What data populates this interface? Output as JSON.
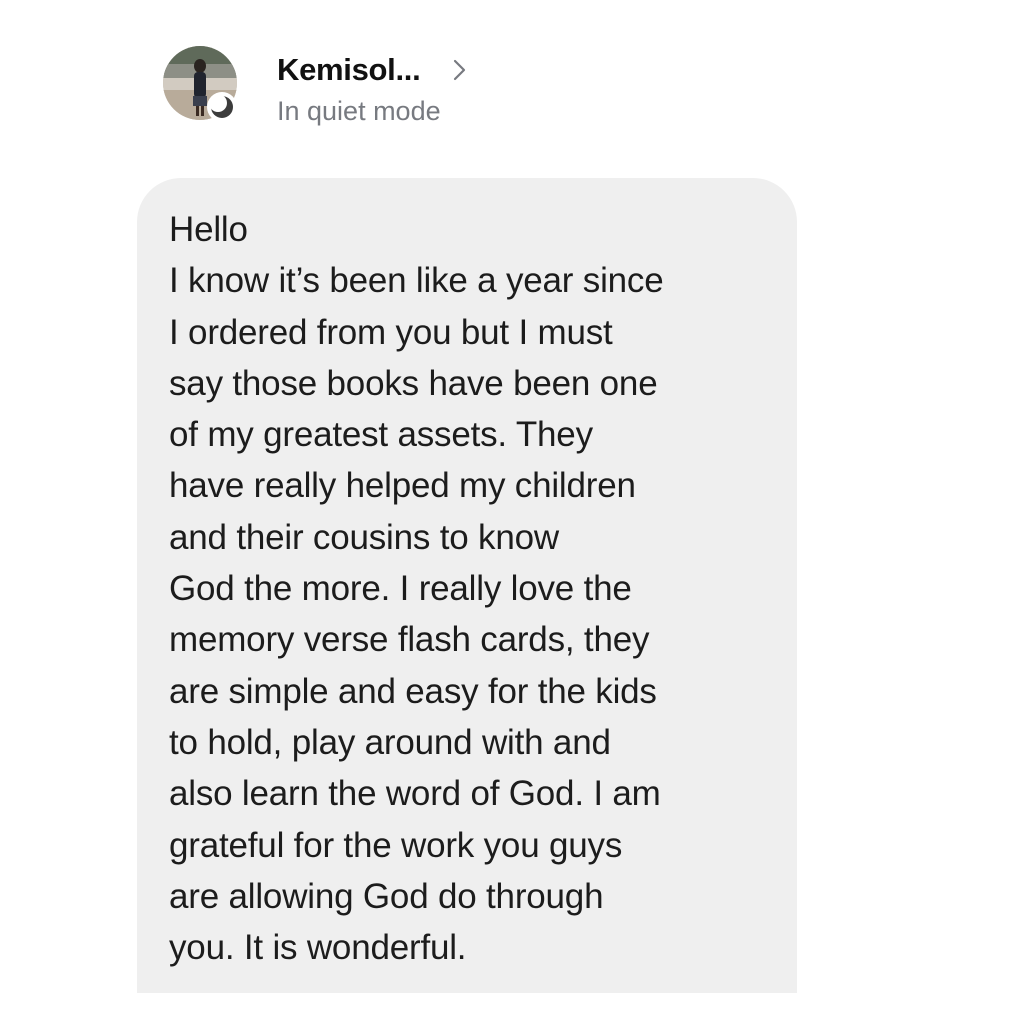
{
  "contact": {
    "name": "Kemisol...",
    "status": "In quiet mode"
  },
  "icons": {
    "avatar": "profile-photo",
    "status": "crescent-moon-icon",
    "chevron": "chevron-right-icon"
  },
  "colors": {
    "bubble_background": "#efefef",
    "status_text": "#777a80",
    "name_text": "#111111"
  },
  "message": {
    "lines": [
      "Hello",
      "I know it’s been like a year since",
      "I ordered from you but I must",
      "say those books have been one",
      "of my greatest assets. They",
      "have really helped my children",
      "and their cousins to know",
      "God the more. I really love the",
      "memory verse flash cards, they",
      "are simple and easy for the kids",
      "to hold, play around with and",
      "also learn the word of God. I am",
      "grateful for the work you guys",
      "are allowing God do through",
      "you. It is wonderful."
    ]
  }
}
